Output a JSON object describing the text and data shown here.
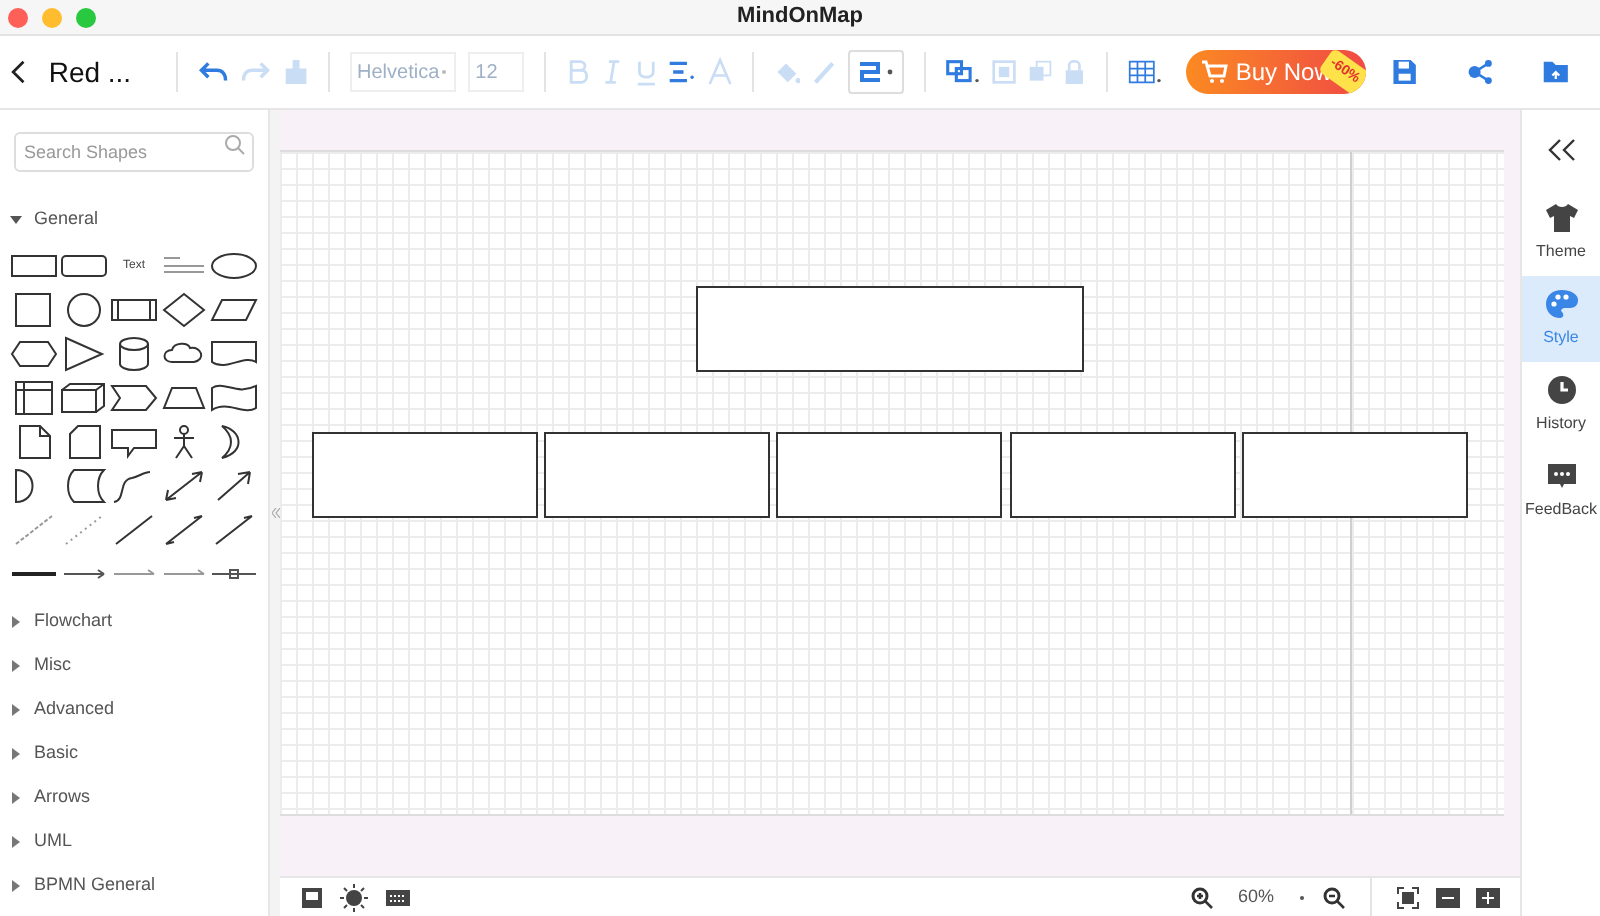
{
  "window": {
    "title": "MindOnMap"
  },
  "toolbar": {
    "document_title": "Red ...",
    "font": "Helvetica",
    "font_size": "12",
    "buy_button": "Buy Now",
    "discount_badge": "-60%"
  },
  "sidebar": {
    "search": {
      "placeholder": "Search Shapes"
    },
    "shape_text": "Text",
    "categories": [
      {
        "label": "General",
        "expanded": true
      },
      {
        "label": "Flowchart",
        "expanded": false
      },
      {
        "label": "Misc",
        "expanded": false
      },
      {
        "label": "Advanced",
        "expanded": false
      },
      {
        "label": "Basic",
        "expanded": false
      },
      {
        "label": "Arrows",
        "expanded": false
      },
      {
        "label": "UML",
        "expanded": false
      },
      {
        "label": "BPMN General",
        "expanded": false
      }
    ]
  },
  "right_panel": {
    "items": [
      {
        "label": "Theme",
        "kind": "theme",
        "selected": false
      },
      {
        "label": "Style",
        "kind": "style",
        "selected": true
      },
      {
        "label": "History",
        "kind": "history",
        "selected": false
      },
      {
        "label": "FeedBack",
        "kind": "feedback",
        "selected": false
      }
    ]
  },
  "status_bar": {
    "zoom": "60%"
  }
}
